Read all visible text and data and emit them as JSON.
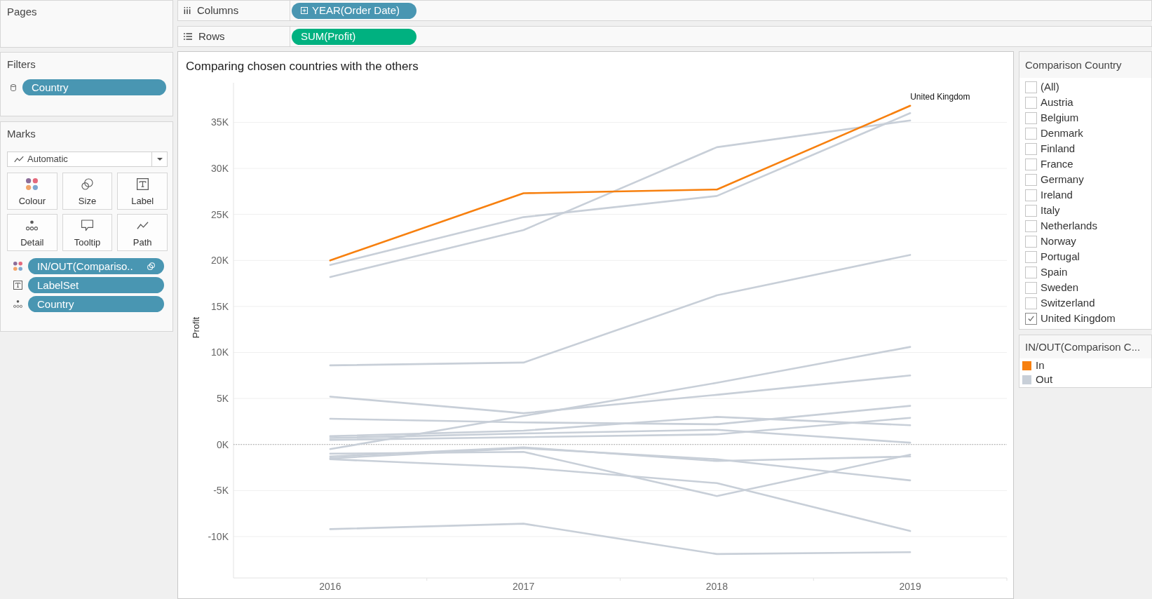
{
  "pages": {
    "title": "Pages"
  },
  "filters": {
    "title": "Filters",
    "pills": [
      {
        "text": "Country",
        "kind": "dimension"
      }
    ]
  },
  "marks": {
    "title": "Marks",
    "mark_type": "Automatic",
    "properties": [
      {
        "label": "Colour",
        "kind": "colour"
      },
      {
        "label": "Size",
        "kind": "size"
      },
      {
        "label": "Label",
        "kind": "label"
      },
      {
        "label": "Detail",
        "kind": "detail"
      },
      {
        "label": "Tooltip",
        "kind": "tooltip"
      },
      {
        "label": "Path",
        "kind": "path"
      }
    ],
    "fields": [
      {
        "text": "IN/OUT(Compariso..",
        "kind": "colour",
        "set": true
      },
      {
        "text": "LabelSet",
        "kind": "label",
        "set": false
      },
      {
        "text": "Country",
        "kind": "detail",
        "set": false
      }
    ]
  },
  "columns_shelf": {
    "label": "Columns",
    "pills": [
      {
        "text": "YEAR(Order Date)",
        "kind": "dimension",
        "drillable": true
      }
    ]
  },
  "rows_shelf": {
    "label": "Rows",
    "pills": [
      {
        "text": "SUM(Profit)",
        "kind": "measure",
        "drillable": false
      }
    ]
  },
  "worksheet": {
    "chart_data": {
      "type": "line",
      "title": "Comparing chosen countries with the others",
      "ylabel": "Profit",
      "categories": [
        "2016",
        "2017",
        "2018",
        "2019"
      ],
      "ylim": [
        -14500,
        39300
      ],
      "yticks": [
        {
          "value": -10000,
          "label": "-10K"
        },
        {
          "value": -5000,
          "label": "-5K"
        },
        {
          "value": 0,
          "label": "0K"
        },
        {
          "value": 5000,
          "label": "5K"
        },
        {
          "value": 10000,
          "label": "10K"
        },
        {
          "value": 15000,
          "label": "15K"
        },
        {
          "value": 20000,
          "label": "20K"
        },
        {
          "value": 25000,
          "label": "25K"
        },
        {
          "value": 30000,
          "label": "30K"
        },
        {
          "value": 35000,
          "label": "35K"
        }
      ],
      "grid": true,
      "ref_lines": [
        {
          "axis": "y",
          "value": 0,
          "color": "#a0a0a0",
          "line_style": "dotted"
        }
      ],
      "series": [
        {
          "color": "#c8cfd8",
          "values": [
            19500,
            24700,
            27000,
            36000
          ]
        },
        {
          "color": "#c8cfd8",
          "values": [
            18200,
            23300,
            32300,
            35200
          ]
        },
        {
          "color": "#c8cfd8",
          "values": [
            8600,
            8900,
            16200,
            20600
          ]
        },
        {
          "color": "#c8cfd8",
          "values": [
            -500,
            3100,
            6700,
            10600
          ]
        },
        {
          "color": "#c8cfd8",
          "values": [
            5200,
            3400,
            5400,
            7500
          ]
        },
        {
          "color": "#c8cfd8",
          "values": [
            2800,
            2400,
            2200,
            4200
          ]
        },
        {
          "color": "#c8cfd8",
          "values": [
            900,
            1500,
            3000,
            2100
          ]
        },
        {
          "color": "#c8cfd8",
          "values": [
            700,
            1200,
            1600,
            200
          ]
        },
        {
          "color": "#c8cfd8",
          "values": [
            500,
            800,
            1100,
            2900
          ]
        },
        {
          "color": "#c8cfd8",
          "values": [
            -1000,
            -800,
            -5600,
            -1100
          ]
        },
        {
          "color": "#c8cfd8",
          "values": [
            -1600,
            -2500,
            -4200,
            -9400
          ]
        },
        {
          "color": "#c8cfd8",
          "values": [
            -1300,
            -300,
            -1800,
            -1300
          ]
        },
        {
          "color": "#c8cfd8",
          "values": [
            -1500,
            -400,
            -1600,
            -3900
          ]
        },
        {
          "color": "#c8cfd8",
          "values": [
            -9200,
            -8600,
            -11900,
            -11700
          ]
        },
        {
          "name": "United Kingdom",
          "color": "#f7800f",
          "values": [
            20000,
            27300,
            27700,
            36800
          ]
        }
      ]
    }
  },
  "comparison_filter": {
    "title": "Comparison Country",
    "items": [
      {
        "label": "(All)",
        "checked": false
      },
      {
        "label": "Austria",
        "checked": false
      },
      {
        "label": "Belgium",
        "checked": false
      },
      {
        "label": "Denmark",
        "checked": false
      },
      {
        "label": "Finland",
        "checked": false
      },
      {
        "label": "France",
        "checked": false
      },
      {
        "label": "Germany",
        "checked": false
      },
      {
        "label": "Ireland",
        "checked": false
      },
      {
        "label": "Italy",
        "checked": false
      },
      {
        "label": "Netherlands",
        "checked": false
      },
      {
        "label": "Norway",
        "checked": false
      },
      {
        "label": "Portugal",
        "checked": false
      },
      {
        "label": "Spain",
        "checked": false
      },
      {
        "label": "Sweden",
        "checked": false
      },
      {
        "label": "Switzerland",
        "checked": false
      },
      {
        "label": "United Kingdom",
        "checked": true
      }
    ]
  },
  "legend": {
    "title": "IN/OUT(Comparison C...",
    "items": [
      {
        "label": "In",
        "color": "#f7800f"
      },
      {
        "label": "Out",
        "color": "#c8cfd8"
      }
    ]
  }
}
